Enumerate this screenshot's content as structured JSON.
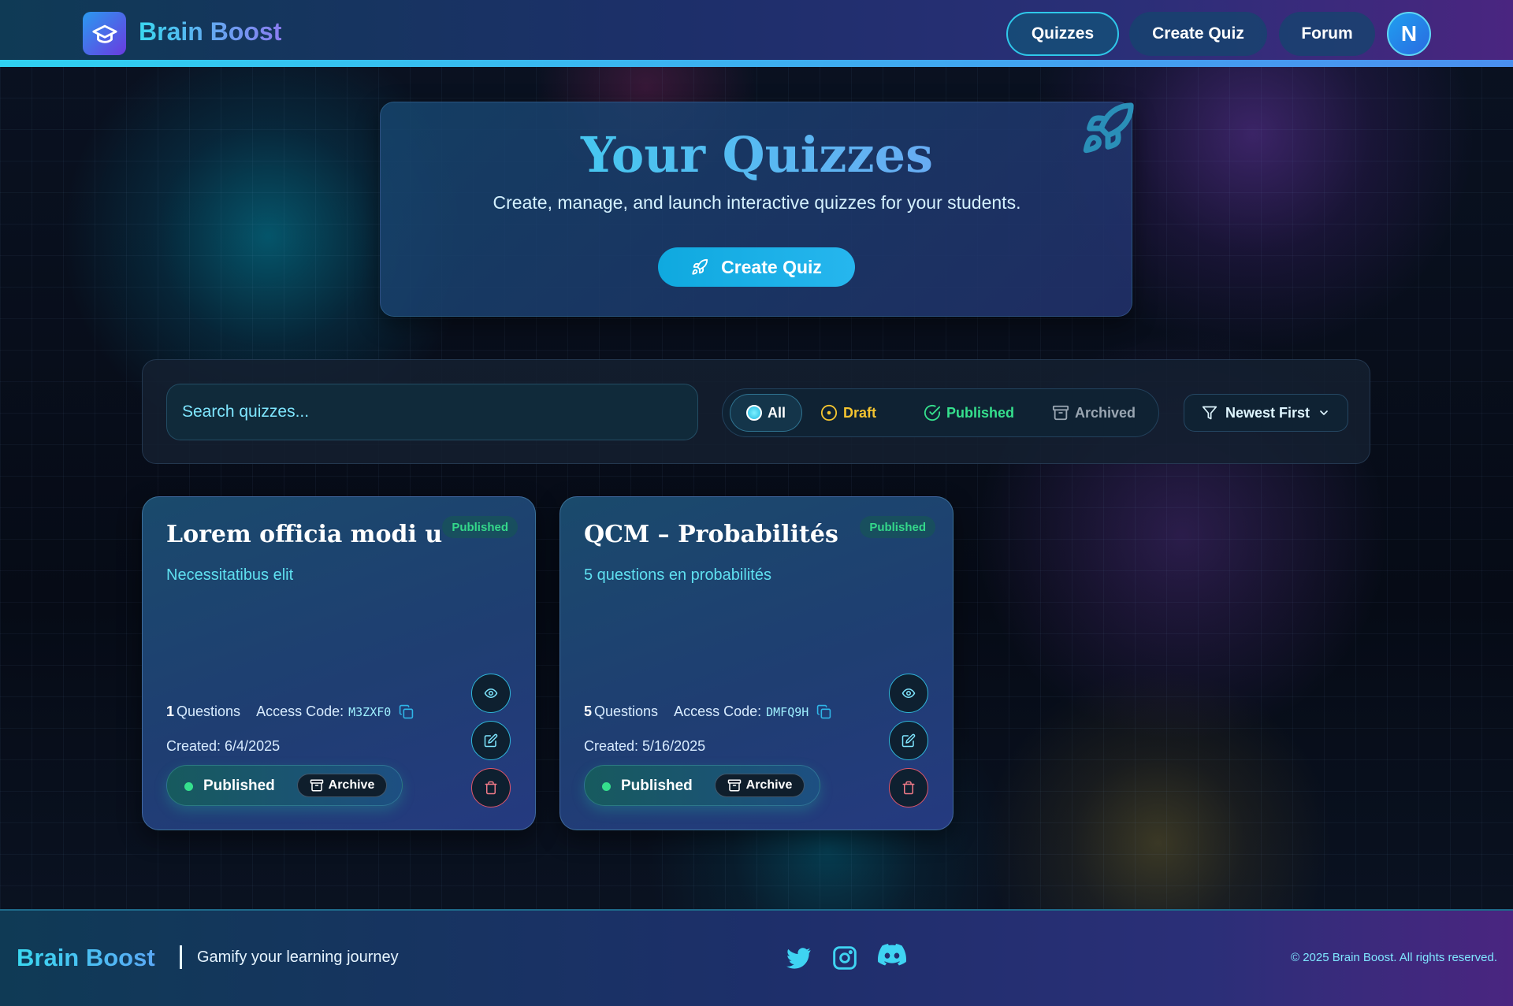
{
  "header": {
    "brand": "Brain Boost",
    "nav": [
      "Quizzes",
      "Create Quiz",
      "Forum"
    ],
    "avatar_initial": "N"
  },
  "hero": {
    "title": "Your Quizzes",
    "subtitle": "Create, manage, and launch interactive quizzes for your students.",
    "button": "Create Quiz"
  },
  "filters": {
    "search_placeholder": "Search quizzes...",
    "segments": [
      "All",
      "Draft",
      "Published",
      "Archived"
    ],
    "active_segment": "All",
    "sort": "Newest First"
  },
  "quizzes": [
    {
      "title": "Lorem officia modi u",
      "badge": "Published",
      "description": "Necessitatibus elit",
      "questions_count": "1",
      "questions_label": "Questions",
      "access_label": "Access Code:",
      "access_code": "M3ZXF0",
      "created": "Created: 6/4/2025",
      "status": "Published",
      "archive": "Archive"
    },
    {
      "title": "QCM – Probabilités",
      "badge": "Published",
      "description": "5 questions en probabilités",
      "questions_count": "5",
      "questions_label": "Questions",
      "access_label": "Access Code:",
      "access_code": "DMFQ9H",
      "created": "Created: 5/16/2025",
      "status": "Published",
      "archive": "Archive"
    }
  ],
  "footer": {
    "brand": "Brain Boost",
    "tagline": "Gamify your learning journey",
    "social_icons": [
      "twitter-icon",
      "instagram-icon",
      "discord-icon"
    ],
    "copyright": "© 2025 Brain Boost. All rights reserved."
  },
  "colors": {
    "accent": "#2fd0f0",
    "published": "#35e08d",
    "draft": "#f4c430",
    "delete": "#e0566a"
  }
}
